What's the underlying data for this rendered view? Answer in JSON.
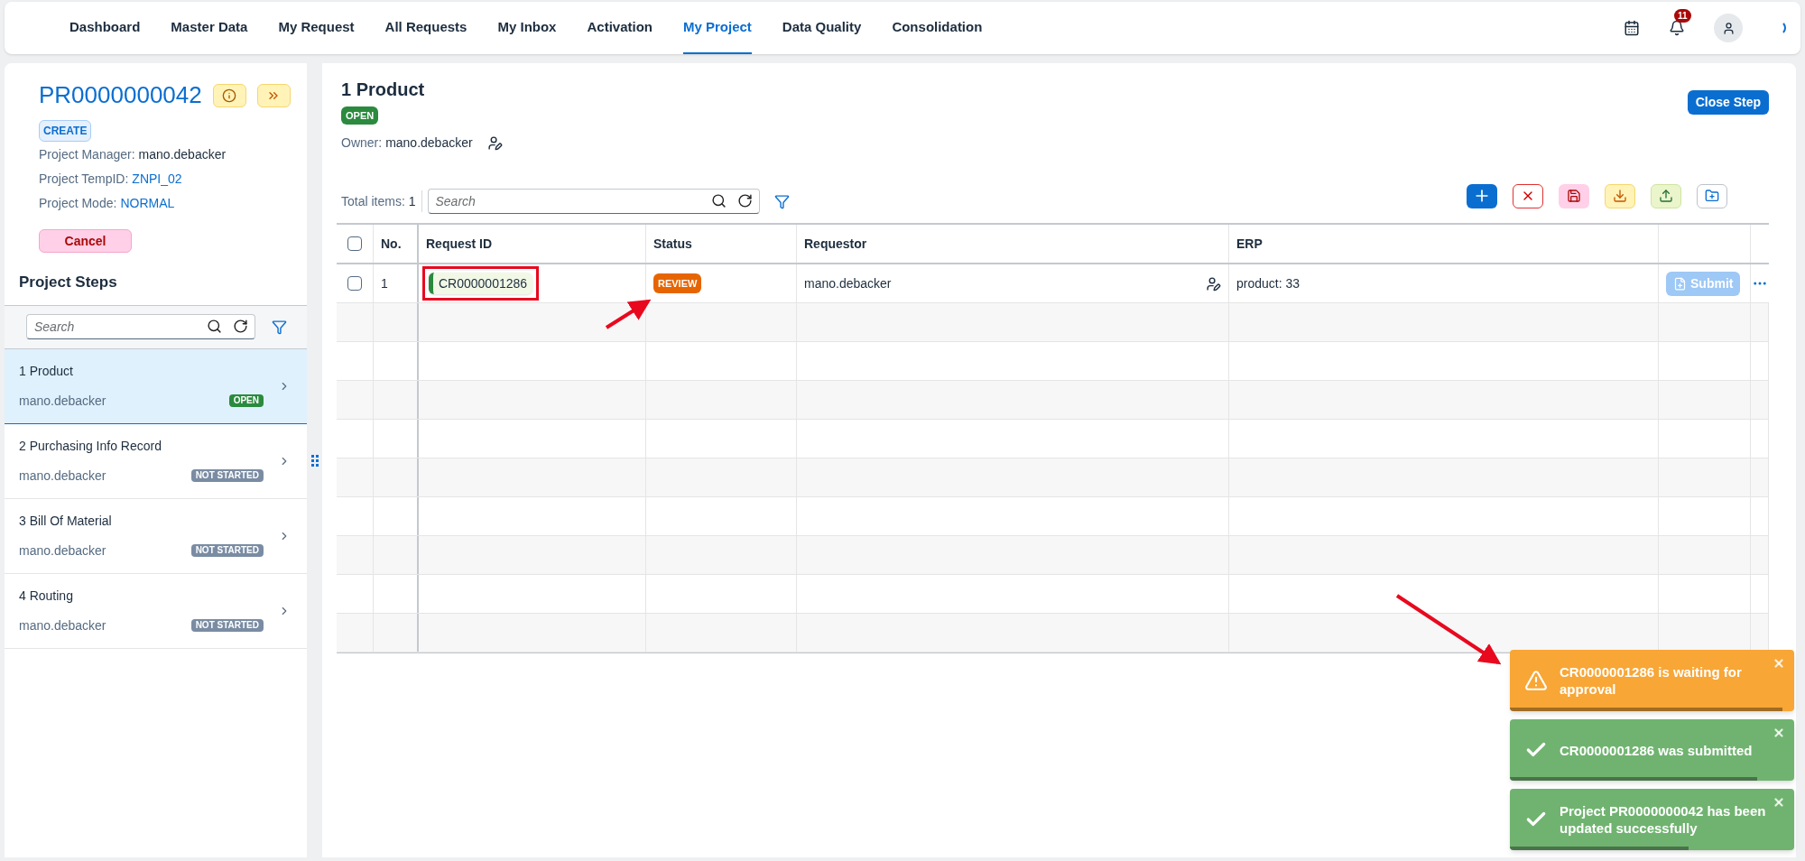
{
  "nav": {
    "items": [
      {
        "label": "Dashboard",
        "selected": false
      },
      {
        "label": "Master Data",
        "selected": false
      },
      {
        "label": "My Request",
        "selected": false
      },
      {
        "label": "All Requests",
        "selected": false
      },
      {
        "label": "My Inbox",
        "selected": false
      },
      {
        "label": "Activation",
        "selected": false
      },
      {
        "label": "My Project",
        "selected": true
      },
      {
        "label": "Data Quality",
        "selected": false
      },
      {
        "label": "Consolidation",
        "selected": false
      }
    ],
    "notification_count": "11"
  },
  "project": {
    "id": "PR0000000042",
    "type_badge": "CREATE",
    "fields": [
      {
        "label": "Project Manager:",
        "value": "mano.debacker",
        "kind": "plain"
      },
      {
        "label": "Project TempID:",
        "value": "ZNPI_02",
        "kind": "link"
      },
      {
        "label": "Project Mode:",
        "value": "NORMAL",
        "kind": "link"
      }
    ],
    "cancel_button": "Cancel"
  },
  "steps": {
    "title": "Project Steps",
    "search_placeholder": "Search",
    "items": [
      {
        "name": "1 Product",
        "owner": "mano.debacker",
        "status": "OPEN",
        "color": "#2b8a3e",
        "selected": true
      },
      {
        "name": "2 Purchasing Info Record",
        "owner": "mano.debacker",
        "status": "NOT STARTED",
        "color": "#7a8ca3",
        "selected": false
      },
      {
        "name": "3 Bill Of Material",
        "owner": "mano.debacker",
        "status": "NOT STARTED",
        "color": "#7a8ca3",
        "selected": false
      },
      {
        "name": "4 Routing",
        "owner": "mano.debacker",
        "status": "NOT STARTED",
        "color": "#7a8ca3",
        "selected": false
      }
    ]
  },
  "step_detail": {
    "title": "1 Product",
    "status": "OPEN",
    "color": "#2b8a3e",
    "owner_label": "Owner:",
    "owner": "mano.debacker",
    "close_button": "Close Step"
  },
  "table": {
    "total_label": "Total items:",
    "total": "1",
    "search_placeholder": "Search",
    "header_checked": false,
    "columns": [
      "No.",
      "Request ID",
      "Status",
      "Requestor",
      "ERP"
    ],
    "rows": [
      {
        "checked": false,
        "no": "1",
        "request_id": "CR0000001286",
        "highlighted": true,
        "status": "REVIEW",
        "requestor": "mano.debacker",
        "erp": "product: 33",
        "action": "Submit",
        "action_disabled": true
      }
    ]
  },
  "toasts": [
    {
      "kind": "warning",
      "text": "CR0000001286 is waiting for approval",
      "level": 0.96
    },
    {
      "kind": "success",
      "text": "CR0000001286 was submitted",
      "level": 0.87
    },
    {
      "kind": "success",
      "text": "Project PR0000000042 has been updated successfully",
      "level": 0.63
    }
  ]
}
